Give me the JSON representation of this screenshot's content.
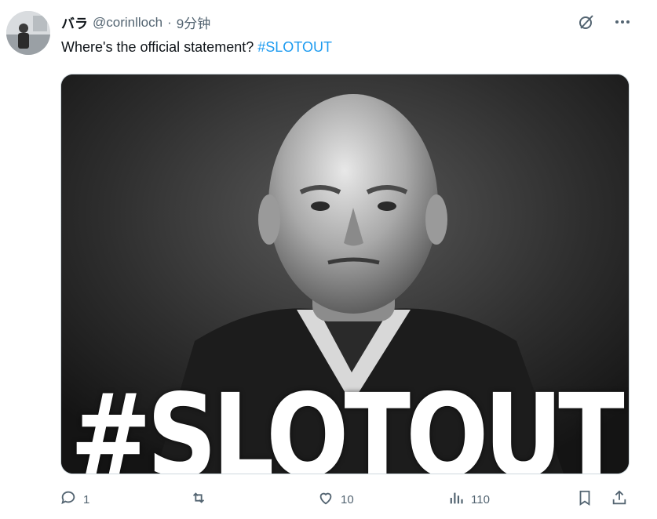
{
  "tweet": {
    "author_name": "バラ",
    "handle": "@corinlloch",
    "separator": "·",
    "time": "9分钟",
    "text": "Where's the official statement?",
    "hashtag": "#SLOTOUT",
    "image_overlay_text": "#SLOTOUT"
  },
  "actions": {
    "reply_count": "1",
    "retweet_count": "",
    "like_count": "10",
    "view_count": "110"
  },
  "colors": {
    "hashtag": "#1d9bf0",
    "secondary_text": "#536471",
    "primary_text": "#0f1419"
  },
  "icons": [
    "grok-icon",
    "more-icon",
    "reply-icon",
    "retweet-icon",
    "like-icon",
    "views-icon",
    "bookmark-icon",
    "share-icon"
  ]
}
